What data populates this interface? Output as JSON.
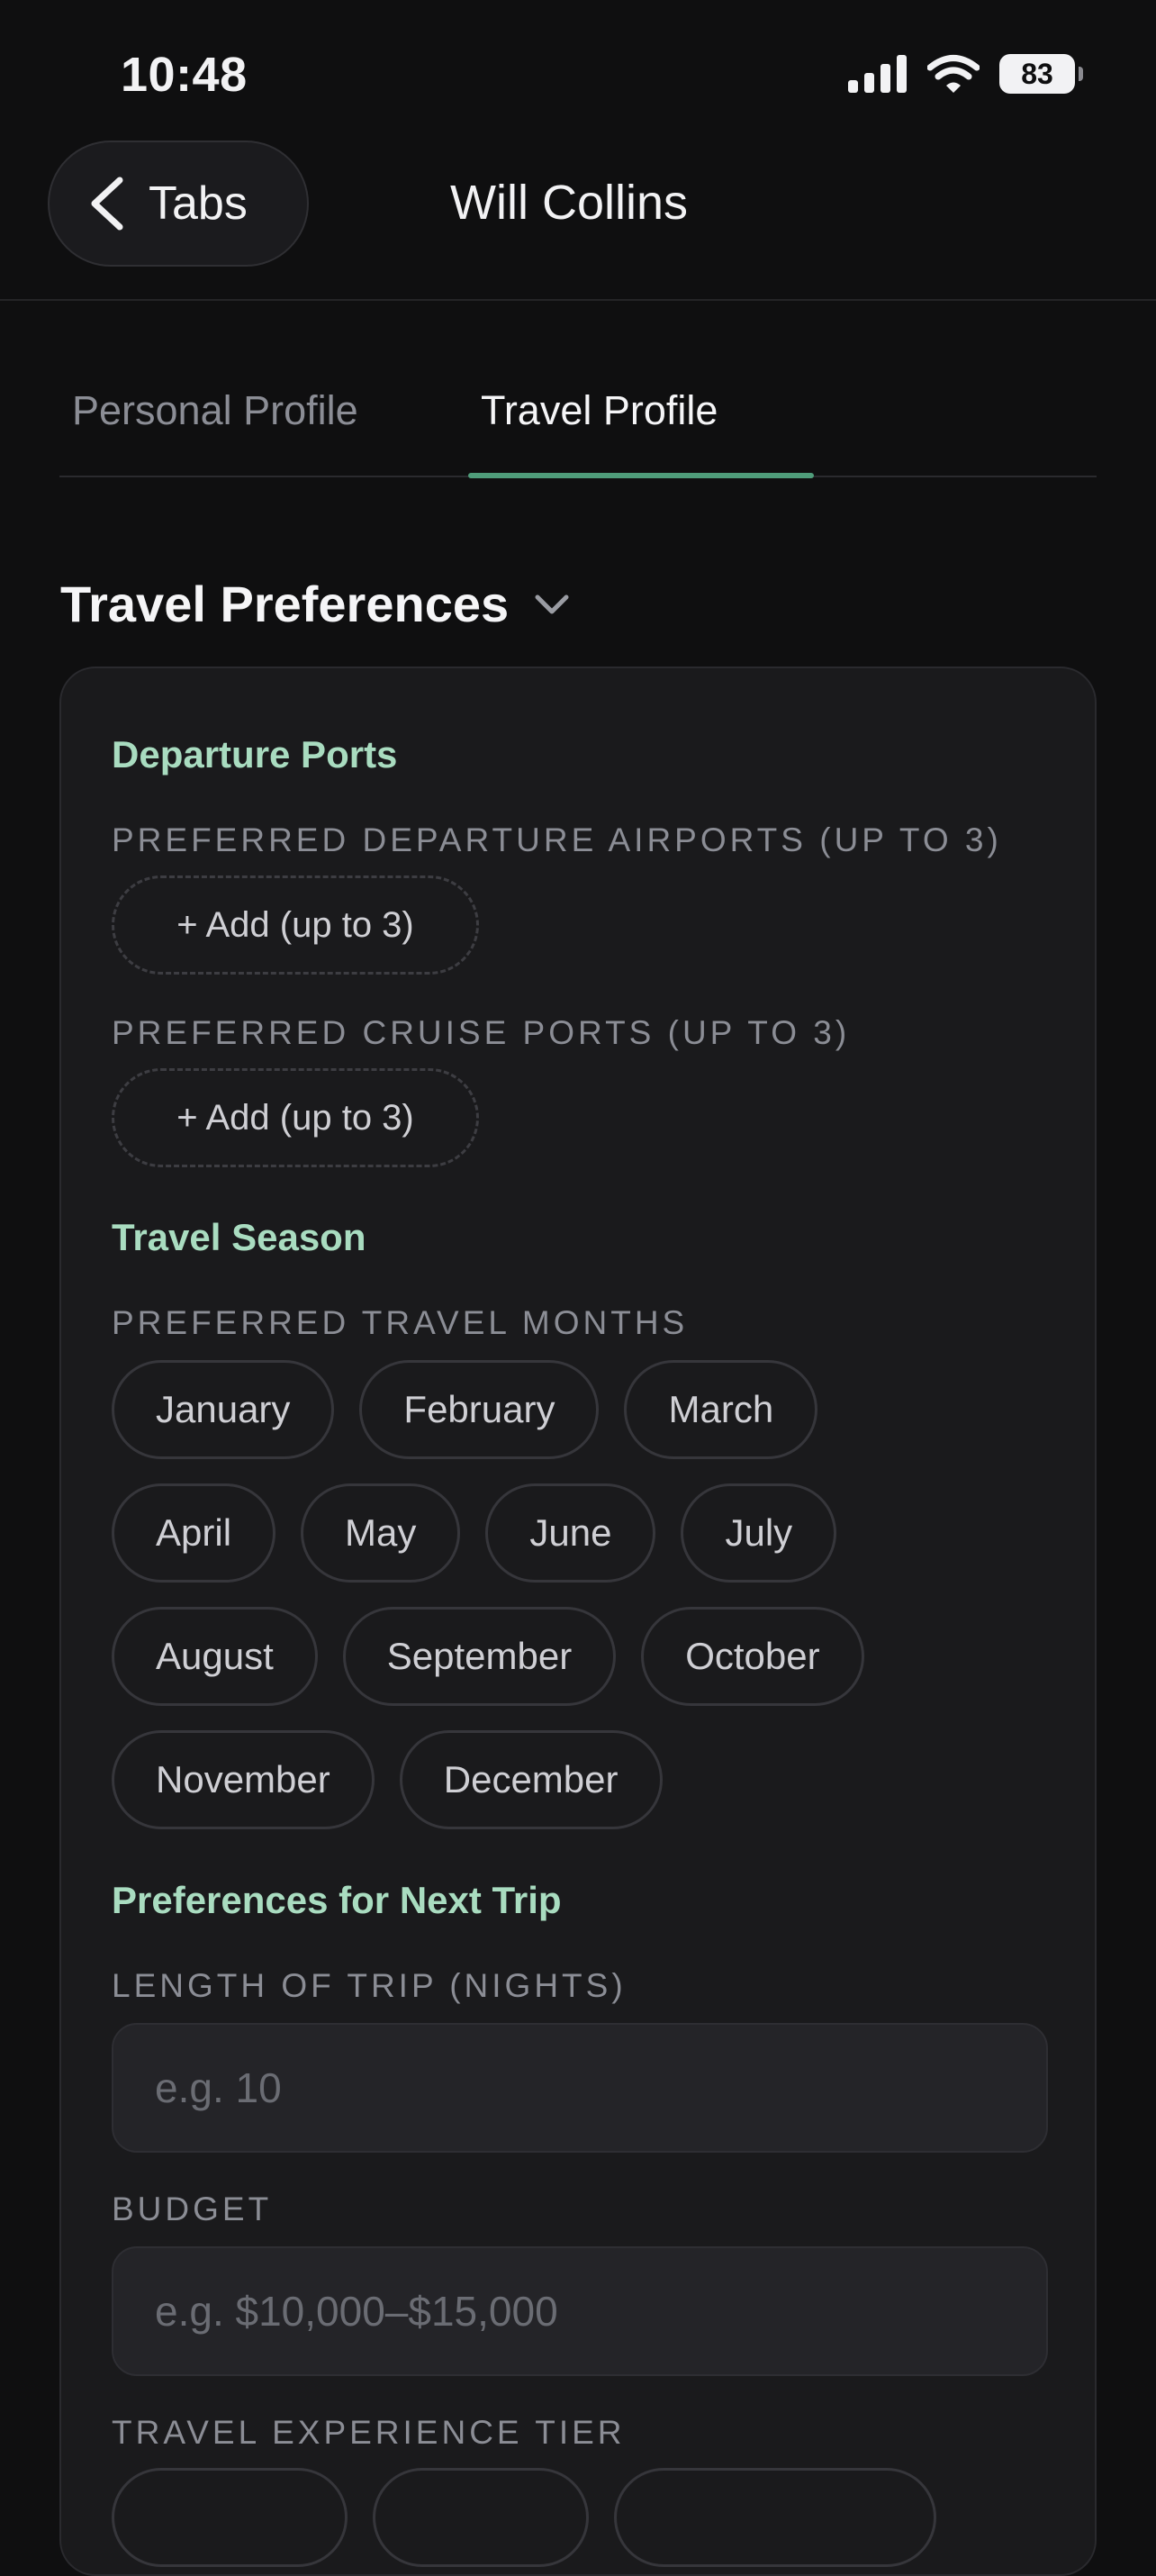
{
  "status_bar": {
    "time": "10:48",
    "battery_level": "83"
  },
  "header": {
    "back_label": "Tabs",
    "title": "Will Collins"
  },
  "tabs": [
    {
      "label": "Personal Profile",
      "active": false
    },
    {
      "label": "Travel Profile",
      "active": true
    }
  ],
  "accent_color": "#4f9d7a",
  "section": {
    "title": "Travel Preferences"
  },
  "departure_ports": {
    "title": "Departure Ports",
    "airports_label": "PREFERRED DEPARTURE AIRPORTS (UP TO 3)",
    "airports_add": "+ Add (up to 3)",
    "cruise_label": "PREFERRED CRUISE PORTS (UP TO 3)",
    "cruise_add": "+ Add (up to 3)"
  },
  "travel_season": {
    "title": "Travel Season",
    "months_label": "PREFERRED TRAVEL MONTHS",
    "months": [
      "January",
      "February",
      "March",
      "April",
      "May",
      "June",
      "July",
      "August",
      "September",
      "October",
      "November",
      "December"
    ]
  },
  "next_trip": {
    "title": "Preferences for Next Trip",
    "length_label": "LENGTH OF TRIP (NIGHTS)",
    "length_placeholder": "e.g. 10",
    "length_value": "",
    "budget_label": "BUDGET",
    "budget_placeholder": "e.g. $10,000–$15,000",
    "budget_value": "",
    "tier_label": "TRAVEL EXPERIENCE TIER"
  }
}
